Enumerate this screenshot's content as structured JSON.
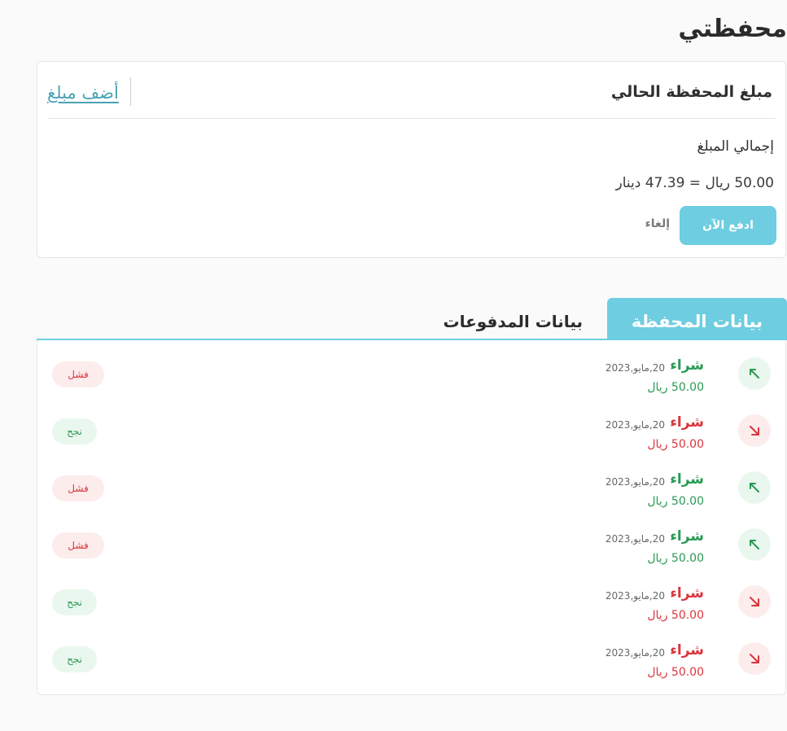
{
  "page": {
    "title": "محفظتي"
  },
  "wallet": {
    "title": "مبلغ المحفظة الحالي",
    "add_amount_label": "أضف مبلغ",
    "total_label": "إجمالي المبلغ",
    "conversion": "50.00 ريال = 47.39 دينار",
    "pay_now_label": "ادفع الآن",
    "cancel_label": "إلغاء"
  },
  "tabs": [
    {
      "label": "بيانات المحفظة",
      "active": true
    },
    {
      "label": "بيانات المدفوعات",
      "active": false
    }
  ],
  "transactions": [
    {
      "direction": "up",
      "title": "شراء",
      "date": "20,مايو,2023",
      "amount": "50.00 ريال",
      "status": "فشل",
      "status_type": "fail"
    },
    {
      "direction": "down",
      "title": "شراء",
      "date": "20,مايو,2023",
      "amount": "50.00 ريال",
      "status": "نجح",
      "status_type": "success"
    },
    {
      "direction": "up",
      "title": "شراء",
      "date": "20,مايو,2023",
      "amount": "50.00 ريال",
      "status": "فشل",
      "status_type": "fail"
    },
    {
      "direction": "up",
      "title": "شراء",
      "date": "20,مايو,2023",
      "amount": "50.00 ريال",
      "status": "فشل",
      "status_type": "fail"
    },
    {
      "direction": "down",
      "title": "شراء",
      "date": "20,مايو,2023",
      "amount": "50.00 ريال",
      "status": "نجح",
      "status_type": "success"
    },
    {
      "direction": "down",
      "title": "شراء",
      "date": "20,مايو,2023",
      "amount": "50.00 ريال",
      "status": "نجح",
      "status_type": "success"
    }
  ],
  "icons": {
    "up": "arrow-up-left-icon",
    "down": "arrow-down-right-icon"
  },
  "colors": {
    "accent": "#6ecde0",
    "link": "#4aa3b5",
    "success": "#2a9a55",
    "success_bg": "#eaf7ee",
    "danger": "#d9363e",
    "danger_bg": "#fdecec"
  }
}
